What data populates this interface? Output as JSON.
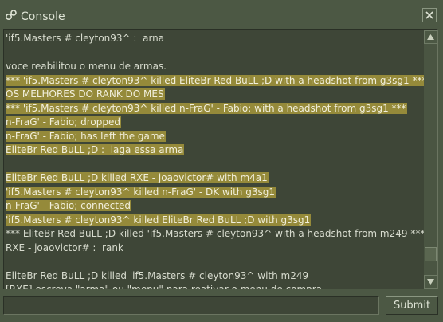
{
  "window": {
    "title": "Console",
    "icon": "steam-icon",
    "close_icon": "close-icon"
  },
  "console": {
    "lines": [
      {
        "text": "'if5.Masters # cleyton93^ :  arna",
        "highlight": false
      },
      {
        "text": "",
        "highlight": false
      },
      {
        "text": "voce reabilitou o menu de armas.",
        "highlight": false
      },
      {
        "text": "*** 'if5.Masters # cleyton93^ killed EliteBr Red BuLL ;D with a headshot from g3sg1 ***",
        "highlight": true
      },
      {
        "text": "OS MELHORES DO RANK DO MES",
        "highlight": true
      },
      {
        "text": "*** 'if5.Masters # cleyton93^ killed n-FraG' - Fabio; with a headshot from g3sg1 ***",
        "highlight": true
      },
      {
        "text": "n-FraG' - Fabio; dropped",
        "highlight": true
      },
      {
        "text": "n-FraG' - Fabio; has left the game",
        "highlight": true
      },
      {
        "text": "EliteBr Red BuLL ;D :  laga essa arma",
        "highlight": true
      },
      {
        "text": "",
        "highlight": false
      },
      {
        "text": "EliteBr Red BuLL ;D killed RXE - joaovictor# with m4a1",
        "highlight": true
      },
      {
        "text": "'if5.Masters # cleyton93^ killed n-FraG' - DK with g3sg1",
        "highlight": true
      },
      {
        "text": "n-FraG' - Fabio; connected",
        "highlight": true
      },
      {
        "text": "'if5.Masters # cleyton93^ killed EliteBr Red BuLL ;D with g3sg1",
        "highlight": true
      },
      {
        "text": "*** EliteBr Red BuLL ;D killed 'if5.Masters # cleyton93^ with a headshot from m249 ***",
        "highlight": false
      },
      {
        "text": "RXE - joaovictor# :  rank",
        "highlight": false
      },
      {
        "text": "",
        "highlight": false
      },
      {
        "text": "EliteBr Red BuLL ;D killed 'if5.Masters # cleyton93^ with m249",
        "highlight": false
      },
      {
        "text": "[RXE] escreva \"arma\" ou \"menu\" para reativar o menu de compra.",
        "highlight": false
      }
    ],
    "scrollbar_up_icon": "triangle-up-icon",
    "scrollbar_down_icon": "triangle-down-icon"
  },
  "command": {
    "value": "",
    "placeholder": "",
    "submit_label": "Submit"
  },
  "colors": {
    "window_bg": "#4c5844",
    "panel_bg": "#3e4637",
    "highlight_bg": "#958a3a",
    "text": "#d8dccf"
  }
}
